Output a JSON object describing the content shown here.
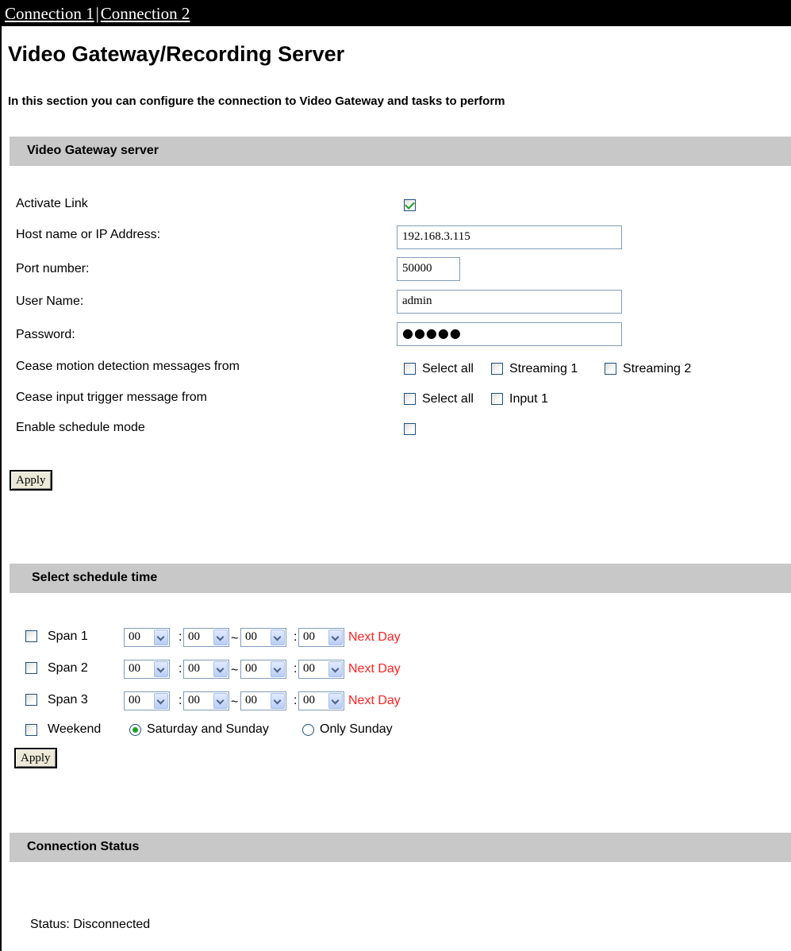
{
  "nav": {
    "connection1": "Connection 1",
    "separator": "|",
    "connection2": "Connection 2"
  },
  "page": {
    "title": "Video Gateway/Recording Server",
    "description": "In this section you can configure the connection to Video Gateway and tasks to perform"
  },
  "gateway": {
    "header": "Video Gateway server",
    "activate_label": "Activate Link",
    "activate_checked": true,
    "host_label": "Host name or IP Address:",
    "host_value": "192.168.3.115",
    "port_label": "Port number:",
    "port_value": "50000",
    "user_label": "User Name:",
    "user_value": "admin",
    "password_label": "Password:",
    "password_mask": "●●●●●",
    "motion_label": "Cease motion detection messages from",
    "motion_options": [
      "Select all",
      "Streaming 1",
      "Streaming 2"
    ],
    "input_label": "Cease input trigger message from",
    "input_options": [
      "Select all",
      "Input 1"
    ],
    "schedule_label": "Enable schedule mode",
    "apply_label": "Apply"
  },
  "schedule": {
    "header": "Select schedule time",
    "spans": [
      {
        "label": "Span 1",
        "h1": "00",
        "m1": "00",
        "h2": "00",
        "m2": "00"
      },
      {
        "label": "Span 2",
        "h1": "00",
        "m1": "00",
        "h2": "00",
        "m2": "00"
      },
      {
        "label": "Span 3",
        "h1": "00",
        "m1": "00",
        "h2": "00",
        "m2": "00"
      }
    ],
    "colon": ":",
    "tilde": "~",
    "next_day": "Next Day",
    "weekend_label": "Weekend",
    "weekend_options": [
      "Saturday and Sunday",
      "Only Sunday"
    ],
    "apply_label": "Apply"
  },
  "status": {
    "header": "Connection Status",
    "text": "Status: Disconnected"
  },
  "colors": {
    "header_bg": "#c8c8c8",
    "next_day": "#ff2020",
    "check": "#21a121"
  }
}
